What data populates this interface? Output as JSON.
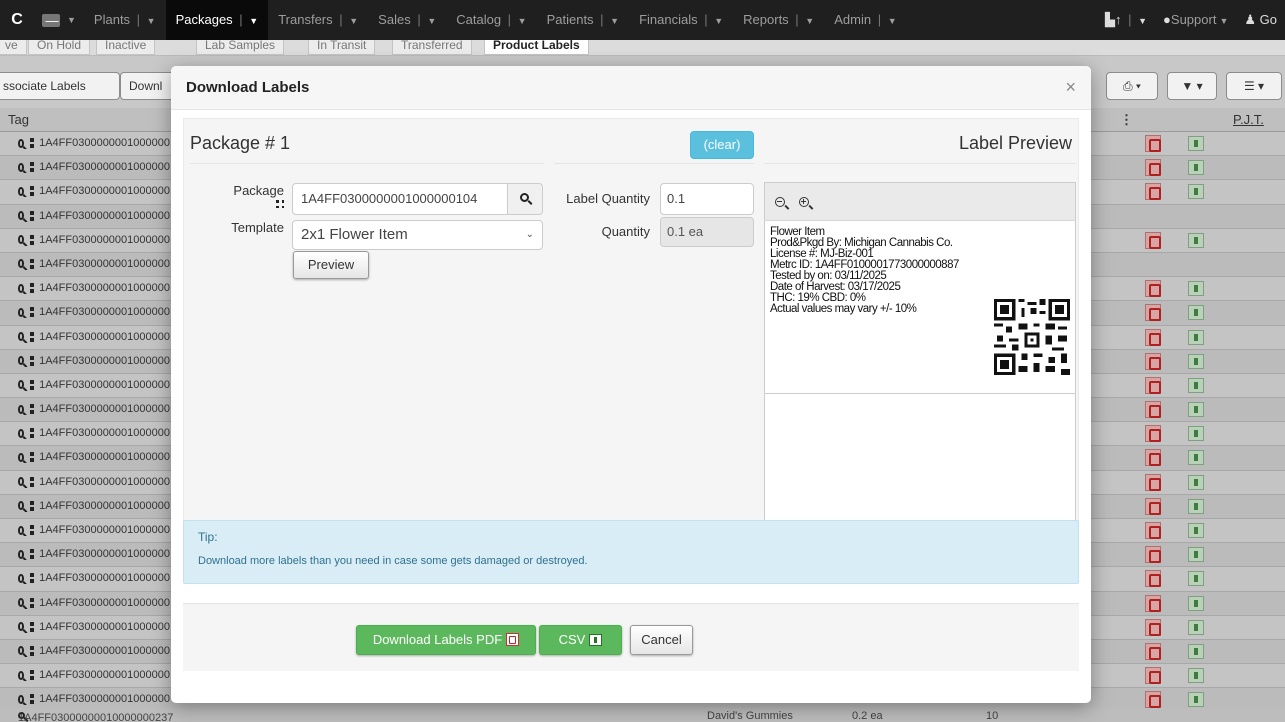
{
  "nav": {
    "brand": "C",
    "items": [
      {
        "label": "Plants"
      },
      {
        "label": "Packages"
      },
      {
        "label": "Transfers"
      },
      {
        "label": "Sales"
      },
      {
        "label": "Catalog"
      },
      {
        "label": "Patients"
      },
      {
        "label": "Financials"
      },
      {
        "label": "Reports"
      },
      {
        "label": "Admin"
      }
    ],
    "support_label": "Support",
    "user_label": "Go"
  },
  "subtabs": [
    {
      "label": "ve"
    },
    {
      "label": "On Hold"
    },
    {
      "label": "Inactive"
    },
    {
      "label": "Lab Samples"
    },
    {
      "label": "In Transit"
    },
    {
      "label": "Transferred"
    },
    {
      "label": "Product Labels"
    }
  ],
  "background": {
    "toolbar": {
      "associate_label": "ssociate Labels",
      "download_label": "Downl"
    },
    "columns": {
      "tag": "Tag",
      "pjt": "P.J.T."
    },
    "row_tag": "1A4FF0300000001000000",
    "bottom_row": {
      "tag": "1A4FF03000000010000000237",
      "item": "David's Gummies",
      "qty": "0.2 ea",
      "count": "10"
    }
  },
  "modal": {
    "title": "Download Labels",
    "close": "×",
    "package_title": "Package # 1",
    "clear_label": "(clear)",
    "preview_title": "Label Preview",
    "package_field_label": "Package",
    "package_value": "1A4FF0300000001000000104",
    "template_label": "Template",
    "template_value": "2x1 Flower Item",
    "preview_button": "Preview",
    "label_quantity_label": "Label Quantity",
    "label_quantity_value": "0.1",
    "quantity_label": "Quantity",
    "quantity_value": "0.1 ea",
    "label_lines": [
      "Flower Item",
      "Prod&Pkgd By: Michigan Cannabis Co.",
      "License #: MJ-Biz-001",
      "Metrc ID: 1A4FF0100001773000000887",
      "Tested by on: 03/11/2025",
      "Date of Harvest: 03/17/2025",
      "THC: 19% CBD: 0%",
      "Actual values may vary +/- 10%"
    ],
    "tip_title": "Tip:",
    "tip_text": "Download more labels than you need in case some gets damaged or destroyed.",
    "download_pdf_label": "Download Labels PDF",
    "csv_label": "CSV",
    "cancel_label": "Cancel"
  },
  "colors": {
    "navbar": "#1f1f1f",
    "success": "#5cb85c",
    "info": "#5bc0de",
    "tip_bg": "#d9edf7",
    "tip_text": "#31708f"
  }
}
